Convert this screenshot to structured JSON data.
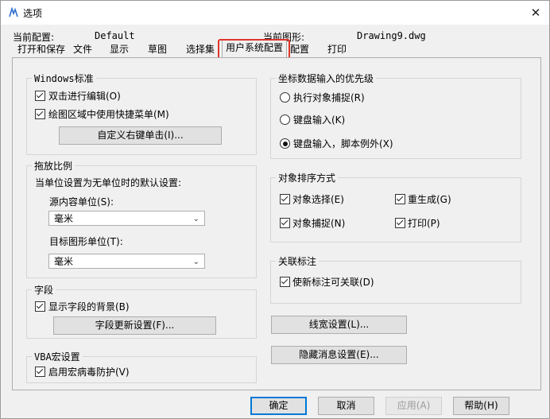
{
  "window": {
    "title": "选项",
    "close": "✕"
  },
  "profile": {
    "current_config_label": "当前配置:",
    "current_config_value": "Default",
    "current_drawing_label": "当前图形:",
    "current_drawing_value": "Drawing9.dwg"
  },
  "tabs": [
    "打开和保存",
    "文件",
    "显示",
    "草图",
    "选择集",
    "用户系统配置",
    "配置",
    "打印"
  ],
  "windows_std": {
    "title": "Windows标准",
    "dblclick": "双击进行编辑(O)",
    "shortcut_menu": "绘图区域中使用快捷菜单(M)",
    "right_click_btn": "自定义右键单击(I)..."
  },
  "insert_scale": {
    "title": "拖放比例",
    "desc": "当单位设置为无单位时的默认设置:",
    "source_label": "源内容单位(S):",
    "source_value": "毫米",
    "target_label": "目标图形单位(T):",
    "target_value": "毫米"
  },
  "fields": {
    "title": "字段",
    "show_bg": "显示字段的背景(B)",
    "update_btn": "字段更新设置(F)..."
  },
  "vba": {
    "title": "VBA宏设置",
    "virus": "启用宏病毒防护(V)"
  },
  "coord_priority": {
    "title": "坐标数据输入的优先级",
    "opt1": "执行对象捕捉(R)",
    "opt2": "键盘输入(K)",
    "opt3": "键盘输入，脚本例外(X)"
  },
  "object_sort": {
    "title": "对象排序方式",
    "select": "对象选择(E)",
    "regen": "重生成(G)",
    "snap": "对象捕捉(N)",
    "plot": "打印(P)"
  },
  "assoc_dim": {
    "title": "关联标注",
    "new_assoc": "使新标注可关联(D)"
  },
  "buttons": {
    "lineweight": "线宽设置(L)...",
    "hidden_msgs": "隐藏消息设置(E)...",
    "ok": "确定",
    "cancel": "取消",
    "apply": "应用(A)",
    "help": "帮助(H)"
  }
}
